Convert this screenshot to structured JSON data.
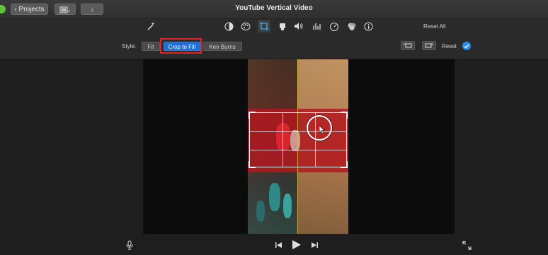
{
  "window": {
    "title": "YouTube Vertical Video",
    "projects_label": "Projects"
  },
  "toolbar": {
    "tools": [
      "magic-wand-icon",
      "color-balance-icon",
      "color-correction-icon",
      "crop-icon",
      "stabilization-icon",
      "volume-icon",
      "equalizer-icon",
      "speed-icon",
      "clip-filter-icon",
      "info-icon"
    ],
    "reset_all_label": "Reset All"
  },
  "crop_controls": {
    "style_label": "Style:",
    "options": [
      "Fit",
      "Crop to Fill",
      "Ken Burns"
    ],
    "selected": "Crop to Fill",
    "reset_label": "Reset"
  },
  "colors": {
    "accent": "#1d6ed8",
    "highlight": "#e8202a",
    "confirm": "#2a8df0"
  }
}
